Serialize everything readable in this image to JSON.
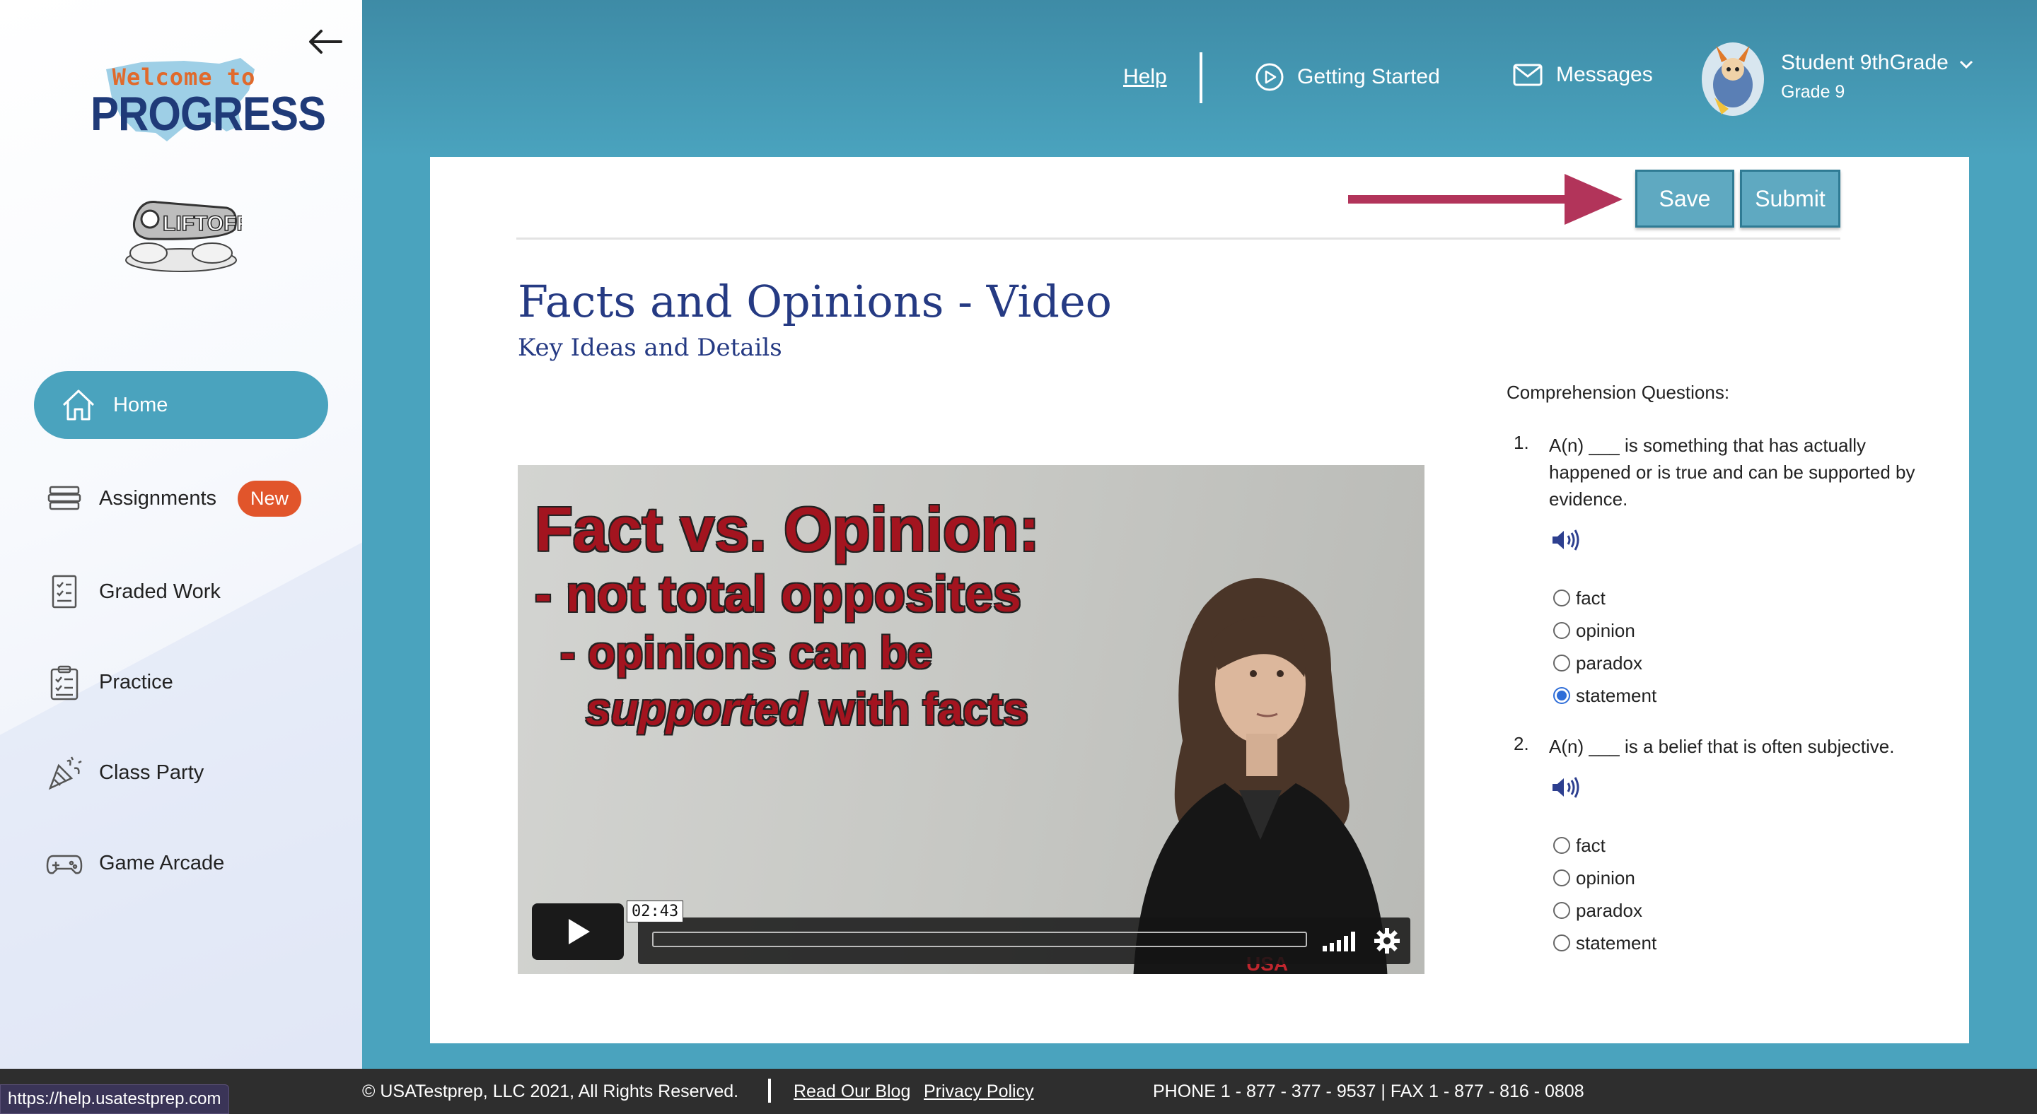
{
  "sidebar": {
    "logo_welcome": "Welcome to",
    "logo_progress": "PROGRESS",
    "liftoff_text": "LIFTOFF",
    "items": [
      {
        "label": "Home",
        "icon": "home-icon",
        "active": true
      },
      {
        "label": "Assignments",
        "icon": "assignments-icon",
        "badge": "New"
      },
      {
        "label": "Graded Work",
        "icon": "graded-work-icon"
      },
      {
        "label": "Practice",
        "icon": "practice-icon"
      },
      {
        "label": "Class Party",
        "icon": "party-popper-icon"
      },
      {
        "label": "Game Arcade",
        "icon": "gamepad-icon"
      }
    ]
  },
  "header": {
    "help": "Help",
    "getting_started": "Getting Started",
    "messages": "Messages",
    "user_name": "Student 9thGrade",
    "user_grade": "Grade 9"
  },
  "toolbar": {
    "save_label": "Save",
    "submit_label": "Submit"
  },
  "lesson": {
    "title": "Facts and Opinions - Video",
    "subtitle": "Key Ideas and Details"
  },
  "video": {
    "line1": "Fact vs. Opinion:",
    "line2": "- not total opposites",
    "line3": "- opinions can be",
    "line4_em": "supported",
    "line4_rest": " with facts",
    "time": "02:43",
    "watermark": "USA",
    "progress": 0.0
  },
  "questions": {
    "heading": "Comprehension Questions:",
    "items": [
      {
        "num": "1.",
        "text": "A(n) ___ is something that has actually happened or is true and can be supported by evidence.",
        "options": [
          "fact",
          "opinion",
          "paradox",
          "statement"
        ],
        "selected": "statement"
      },
      {
        "num": "2.",
        "text": "A(n) ___ is a belief that is often subjective.",
        "options": [
          "fact",
          "opinion",
          "paradox",
          "statement"
        ],
        "selected": null
      }
    ]
  },
  "footer": {
    "copyright": "© USATestprep, LLC 2021, All Rights Reserved.",
    "blog": "Read Our Blog",
    "privacy": "Privacy Policy",
    "phone": "PHONE 1 - 877 - 377 - 9537 | FAX 1 - 877 - 816 - 0808"
  },
  "status_url": "https://help.usatestprep.com",
  "colors": {
    "accent": "#4aa3be",
    "title": "#253a83",
    "badge": "#e1552b",
    "arrow": "#b2345a",
    "radio": "#2f6ed8"
  }
}
